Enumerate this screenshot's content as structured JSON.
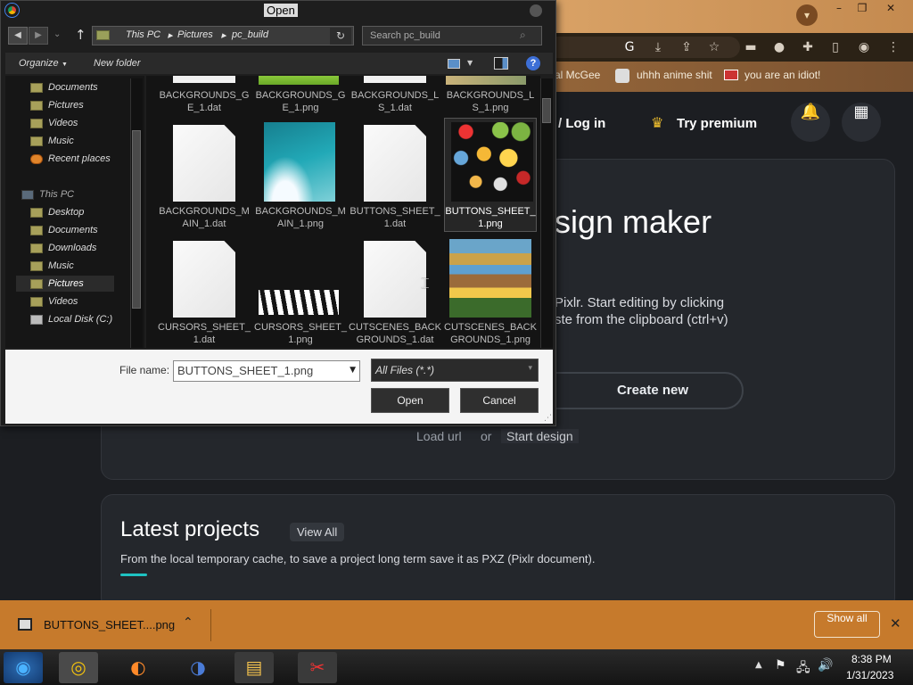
{
  "dialog": {
    "title": "Open",
    "breadcrumb": [
      "This PC",
      "Pictures",
      "pc_build"
    ],
    "search_placeholder": "Search pc_build",
    "organize_label": "Organize",
    "new_folder_label": "New folder",
    "nav": {
      "quick_items": [
        "Documents",
        "Pictures",
        "Videos",
        "Music",
        "Recent places"
      ],
      "this_pc_label": "This PC",
      "pc_items": [
        "Desktop",
        "Documents",
        "Downloads",
        "Music",
        "Pictures",
        "Videos",
        "Local Disk (C:)"
      ],
      "selected": "Pictures"
    },
    "files": [
      {
        "name": "BACKGROUNDS_GE_1.dat"
      },
      {
        "name": "BACKGROUNDS_GE_1.png"
      },
      {
        "name": "BACKGROUNDS_LS_1.dat"
      },
      {
        "name": "BACKGROUNDS_LS_1.png"
      },
      {
        "name": "BACKGROUNDS_MAIN_1.dat"
      },
      {
        "name": "BACKGROUNDS_MAIN_1.png"
      },
      {
        "name": "BUTTONS_SHEET_1.dat"
      },
      {
        "name": "BUTTONS_SHEET_1.png"
      },
      {
        "name": "CURSORS_SHEET_1.dat"
      },
      {
        "name": "CURSORS_SHEET_1.png"
      },
      {
        "name": "CUTSCENES_BACKGROUNDS_1.dat"
      },
      {
        "name": "CUTSCENES_BACKGROUNDS_1.png"
      }
    ],
    "selected_file": "BUTTONS_SHEET_1.png",
    "file_name_label": "File name:",
    "file_name_value": "BUTTONS_SHEET_1.png",
    "file_type": "All Files (*.*)",
    "open_label": "Open",
    "cancel_label": "Cancel"
  },
  "browser": {
    "bookmarks": [
      "al McGee",
      "uhhh anime shit",
      "you are an idiot!"
    ],
    "window_buttons": [
      "–",
      "❐",
      "✕"
    ]
  },
  "pixlr": {
    "login_label": "/ Log in",
    "premium_label": "Try premium",
    "hero_title": "sign maker",
    "hero_line1": "Pixlr. Start editing by clicking",
    "hero_line2": "ste from the clipboard (ctrl+v)",
    "create_label": "Create new",
    "load_url_label": "Load url",
    "or_label": "or",
    "start_design_label": "Start design",
    "latest_title": "Latest projects",
    "view_all_label": "View All",
    "latest_desc": "From the local temporary cache, to save a project long term save it as PXZ (Pixlr document)."
  },
  "download_bar": {
    "file_label": "BUTTONS_SHEET....png",
    "show_all_label": "Show all"
  },
  "taskbar": {
    "time": "8:38 PM",
    "date": "1/31/2023"
  },
  "colors": {
    "accent": "#1ec2c2",
    "download_bar": "#c67a2c",
    "premium_crown": "#f2c12e"
  }
}
